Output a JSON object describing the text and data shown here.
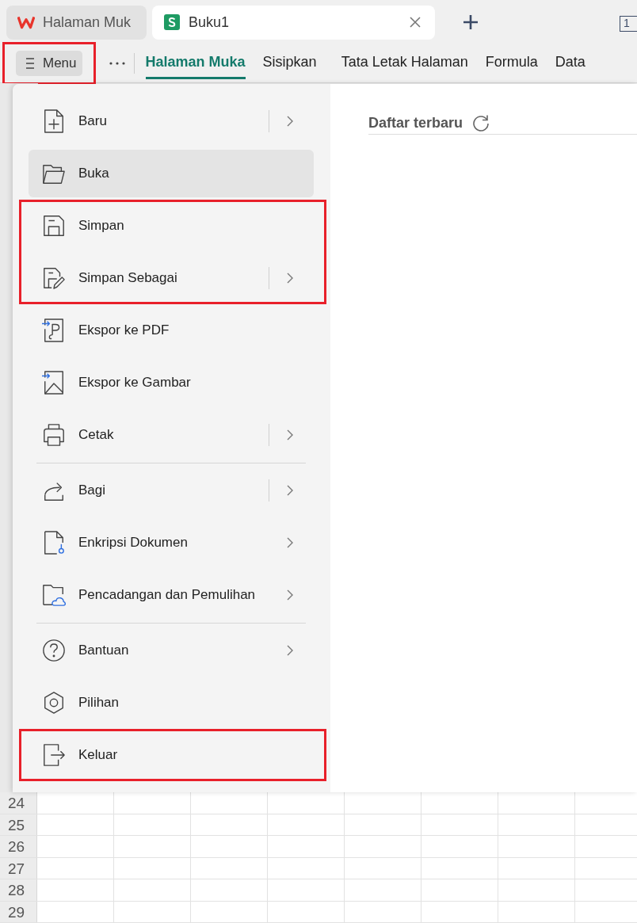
{
  "browser_tabs": [
    {
      "label": "Halaman Muk",
      "kind": "wps",
      "selected": false
    },
    {
      "label": "Buku1",
      "kind": "sheet",
      "selected": true
    }
  ],
  "window_counter": "1",
  "toolbar": {
    "menu_button": {
      "label": "Menu",
      "highlighted": true
    },
    "ribbon_tabs": [
      {
        "label": "Halaman Muka",
        "selected": true
      },
      {
        "label": "Sisipkan",
        "selected": false
      },
      {
        "label": "Tata Letak Halaman",
        "selected": false
      },
      {
        "label": "Formula",
        "selected": false
      },
      {
        "label": "Data",
        "selected": false
      }
    ]
  },
  "menu": {
    "sections": [
      {
        "blocks": [
          {
            "highlighted": false,
            "items": [
              {
                "label": "Baru",
                "kind": "new",
                "submenu": true,
                "split": true,
                "selected": false
              },
              {
                "label": "Buka",
                "kind": "open",
                "submenu": false,
                "split": false,
                "selected": true
              }
            ]
          },
          {
            "highlighted": true,
            "items": [
              {
                "label": "Simpan",
                "kind": "save",
                "submenu": false,
                "split": false,
                "selected": false
              },
              {
                "label": "Simpan Sebagai",
                "kind": "saveas",
                "submenu": true,
                "split": true,
                "selected": false
              }
            ]
          },
          {
            "highlighted": false,
            "items": [
              {
                "label": "Ekspor ke PDF",
                "kind": "pdf",
                "submenu": false,
                "split": false,
                "selected": false
              },
              {
                "label": "Ekspor ke Gambar",
                "kind": "image",
                "submenu": false,
                "split": false,
                "selected": false
              },
              {
                "label": "Cetak",
                "kind": "print",
                "submenu": true,
                "split": true,
                "selected": false
              }
            ]
          }
        ]
      },
      {
        "blocks": [
          {
            "highlighted": false,
            "items": [
              {
                "label": "Bagi",
                "kind": "share",
                "submenu": true,
                "split": true,
                "selected": false
              },
              {
                "label": "Enkripsi Dokumen",
                "kind": "encrypt",
                "submenu": true,
                "split": false,
                "selected": false
              },
              {
                "label": "Pencadangan dan Pemulihan",
                "kind": "backup",
                "submenu": true,
                "split": false,
                "selected": false
              }
            ]
          }
        ]
      },
      {
        "blocks": [
          {
            "highlighted": false,
            "items": [
              {
                "label": "Bantuan",
                "kind": "help",
                "submenu": true,
                "split": false,
                "selected": false
              },
              {
                "label": "Pilihan",
                "kind": "options",
                "submenu": false,
                "split": false,
                "selected": false
              }
            ]
          },
          {
            "highlighted": true,
            "items": [
              {
                "label": "Keluar",
                "kind": "exit",
                "submenu": false,
                "split": false,
                "selected": false
              }
            ]
          }
        ]
      }
    ]
  },
  "recent": {
    "title": "Daftar terbaru"
  },
  "sheet": {
    "rows": [
      "24",
      "25",
      "26",
      "27",
      "28",
      "29"
    ]
  }
}
